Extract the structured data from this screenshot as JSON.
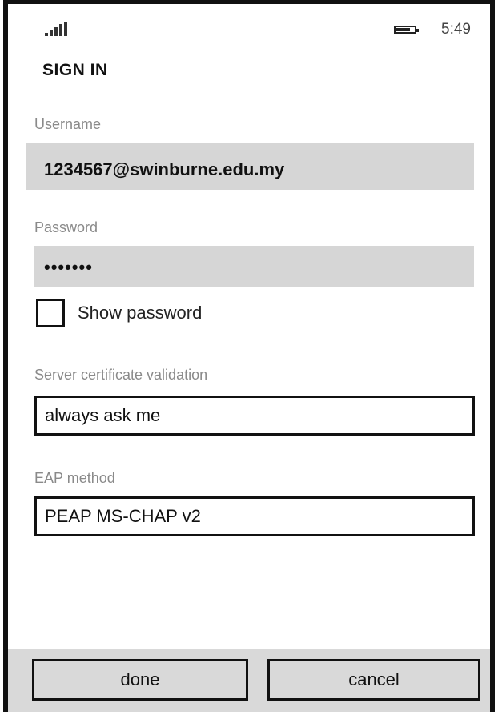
{
  "status_bar": {
    "time": "5:49",
    "signal_icon": "signal-strength-icon",
    "battery_icon": "battery-icon",
    "battery_level": 0.75
  },
  "page": {
    "title": "SIGN IN"
  },
  "form": {
    "username_label": "Username",
    "username_value": "1234567@swinburne.edu.my",
    "password_label": "Password",
    "password_value": "•••••••",
    "show_password_label": "Show password",
    "show_password_checked": false,
    "cert_label": "Server certificate validation",
    "cert_value": "always ask me",
    "eap_label": "EAP method",
    "eap_value": "PEAP MS-CHAP v2"
  },
  "app_bar": {
    "done_label": "done",
    "cancel_label": "cancel"
  }
}
